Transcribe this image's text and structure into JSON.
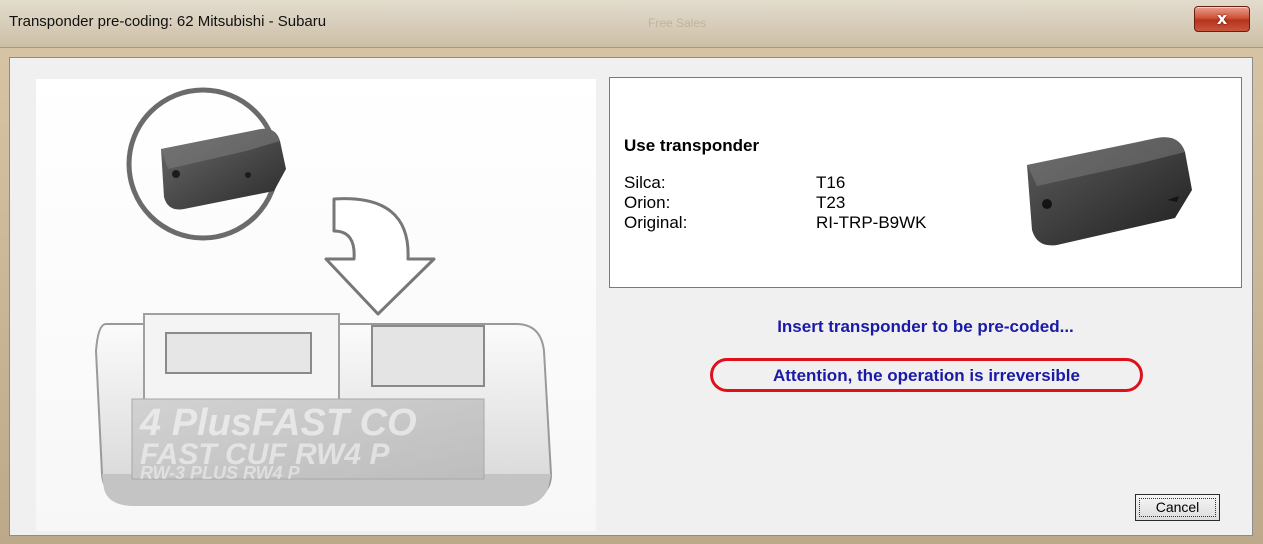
{
  "window": {
    "title": "Transponder pre-coding: 62 Mitsubishi - Subaru",
    "background_title": "Free Sales",
    "close_glyph": "x"
  },
  "illustration": {
    "description_icon": "transponder-into-reader-icon",
    "device_screen_text": [
      "4 PlusFAST CO",
      "FAST  CUF RW4 P",
      "RW-3  PLUS  RW4 P"
    ]
  },
  "info_panel": {
    "title": "Use transponder",
    "specs": [
      {
        "label": "Silca:",
        "value": "T16"
      },
      {
        "label": "Orion:",
        "value": "T23"
      },
      {
        "label": "Original:",
        "value": "RI-TRP-B9WK"
      }
    ],
    "photo_icon": "transponder-chip-photo"
  },
  "messages": {
    "insert": "Insert transponder to be pre-coded...",
    "attention": "Attention, the operation is irreversible"
  },
  "buttons": {
    "cancel": "Cancel"
  },
  "colors": {
    "message_text": "#1a1aa6",
    "attention_outline": "#e0101a",
    "close_button": "#c9563f"
  }
}
